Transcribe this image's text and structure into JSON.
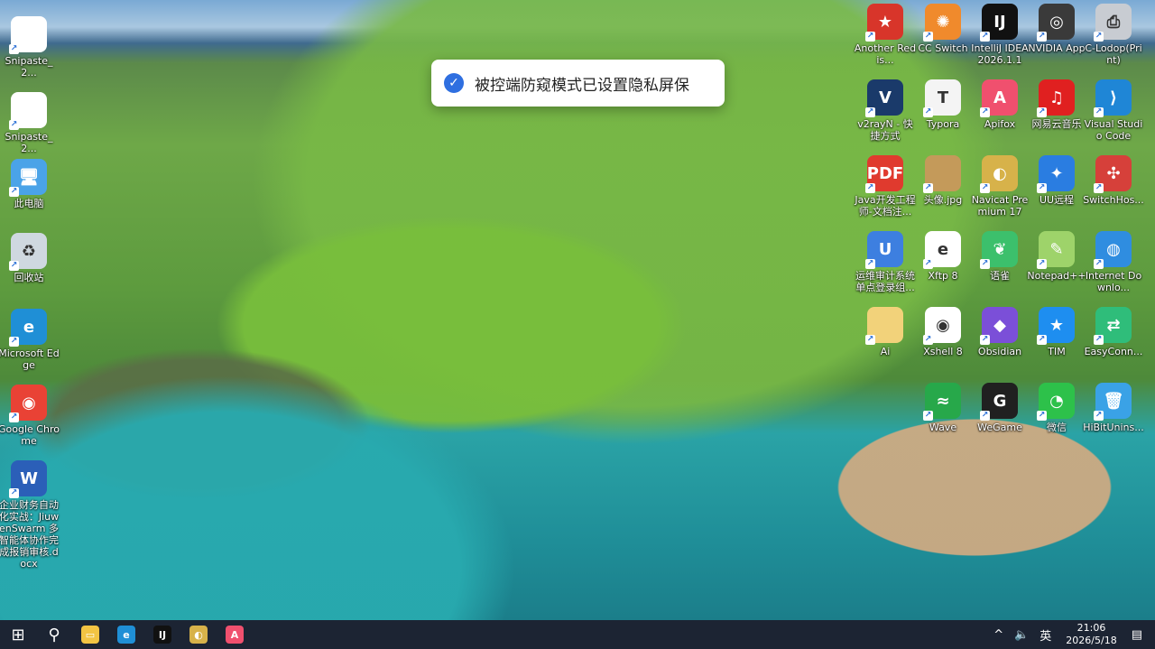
{
  "toast": {
    "message": "被控端防窥模式已设置隐私屏保"
  },
  "left_icons": [
    {
      "name": "snipaste-1",
      "label": "Snipaste_2...",
      "glyph": "",
      "bg": "#ffffff"
    },
    {
      "name": "snipaste-2",
      "label": "Snipaste_2...",
      "glyph": "",
      "bg": "#ffffff"
    },
    {
      "name": "this-pc",
      "label": "此电脑",
      "glyph": "🖥",
      "bg": "#4aa3e8"
    },
    {
      "name": "recycle-bin",
      "label": "回收站",
      "glyph": "♻",
      "bg": "#cfd8e0"
    },
    {
      "name": "edge",
      "label": "Microsoft Edge",
      "glyph": "e",
      "bg": "#1f8fd6"
    },
    {
      "name": "chrome",
      "label": "Google Chrome",
      "glyph": "◉",
      "bg": "#e94235"
    },
    {
      "name": "word-doc",
      "label": "企业财务自动化实战：JiuwenSwarm 多智能体协作完成报销审核.docx",
      "glyph": "W",
      "bg": "#2b5fb8"
    }
  ],
  "right_icons": [
    {
      "name": "another-redis",
      "label": "Another Redis...",
      "glyph": "★",
      "bg": "#d8352a"
    },
    {
      "name": "cc-switch",
      "label": "CC Switch",
      "glyph": "✺",
      "bg": "#f08a2c"
    },
    {
      "name": "intellij-idea",
      "label": "IntelliJ IDEA 2026.1.1",
      "glyph": "IJ",
      "bg": "#111111"
    },
    {
      "name": "nvidia-app",
      "label": "NVIDIA App",
      "glyph": "◎",
      "bg": "#3a3a3a"
    },
    {
      "name": "c-lodop",
      "label": "C-Lodop(Print)",
      "glyph": "⎙",
      "bg": "#c8ccd2"
    },
    {
      "name": "v2rayn",
      "label": "v2rayN - 快捷方式",
      "glyph": "V",
      "bg": "#1a3a6a"
    },
    {
      "name": "typora",
      "label": "Typora",
      "glyph": "T",
      "bg": "#f4f4f4"
    },
    {
      "name": "apifox",
      "label": "Apifox",
      "glyph": "A",
      "bg": "#f0506e"
    },
    {
      "name": "netease-music",
      "label": "网易云音乐",
      "glyph": "♫",
      "bg": "#e02020"
    },
    {
      "name": "vscode",
      "label": "Visual Studio Code",
      "glyph": "⟩",
      "bg": "#1f86d6"
    },
    {
      "name": "java-pdf",
      "label": "Java开发工程师-文档注...",
      "glyph": "PDF",
      "bg": "#e03a2e"
    },
    {
      "name": "avatar-jpg",
      "label": "头像.jpg",
      "glyph": "",
      "bg": "#c49a5a"
    },
    {
      "name": "navicat",
      "label": "Navicat Premium 17",
      "glyph": "◐",
      "bg": "#d7b24a"
    },
    {
      "name": "uu-remote",
      "label": "UU远程",
      "glyph": "✦",
      "bg": "#2a7de1"
    },
    {
      "name": "switchhosts",
      "label": "SwitchHos...",
      "glyph": "✣",
      "bg": "#d6403a"
    },
    {
      "name": "audit-sso",
      "label": "运维审计系统单点登录组...",
      "glyph": "U",
      "bg": "#3d7fe0"
    },
    {
      "name": "xftp",
      "label": "Xftp 8",
      "glyph": "e",
      "bg": "#ffffff"
    },
    {
      "name": "yuque",
      "label": "语雀",
      "glyph": "❦",
      "bg": "#3cc06c"
    },
    {
      "name": "notepadpp",
      "label": "Notepad++",
      "glyph": "✎",
      "bg": "#9ed36a"
    },
    {
      "name": "idm",
      "label": "Internet Downlo...",
      "glyph": "◍",
      "bg": "#2f8de0"
    },
    {
      "name": "ai-folder",
      "label": "Ai",
      "glyph": "",
      "bg": "#f2d27a"
    },
    {
      "name": "xshell",
      "label": "Xshell 8",
      "glyph": "◉",
      "bg": "#ffffff"
    },
    {
      "name": "obsidian",
      "label": "Obsidian",
      "glyph": "◆",
      "bg": "#7b4fd8"
    },
    {
      "name": "tim",
      "label": "TIM",
      "glyph": "★",
      "bg": "#1e8ef0"
    },
    {
      "name": "easyconnect",
      "label": "EasyConn...",
      "glyph": "⇄",
      "bg": "#2fbd7a"
    },
    {
      "name": "wave",
      "label": "Wave",
      "glyph": "≈",
      "bg": "#27a84a"
    },
    {
      "name": "wegame",
      "label": "WeGame",
      "glyph": "G",
      "bg": "#202020"
    },
    {
      "name": "wechat",
      "label": "微信",
      "glyph": "◔",
      "bg": "#2dc14a"
    },
    {
      "name": "hibit-uninstaller",
      "label": "HiBitUnins...",
      "glyph": "🗑",
      "bg": "#3aa2e6"
    }
  ],
  "taskbar": {
    "apps": [
      {
        "name": "start-icon",
        "glyph": "⊞",
        "bg": "transparent"
      },
      {
        "name": "search-icon",
        "glyph": "⚲",
        "bg": "transparent"
      },
      {
        "name": "file-explorer-icon",
        "glyph": "▭",
        "bg": "#f2c443"
      },
      {
        "name": "edge-icon",
        "glyph": "e",
        "bg": "#1f8fd6"
      },
      {
        "name": "intellij-icon",
        "glyph": "IJ",
        "bg": "#111111"
      },
      {
        "name": "navicat-icon",
        "glyph": "◐",
        "bg": "#d7b24a"
      },
      {
        "name": "apifox-icon",
        "glyph": "A",
        "bg": "#f0506e"
      }
    ],
    "tray": {
      "chevron": "^",
      "volume": "🔈",
      "ime": "英",
      "time": "21:06",
      "date": "2026/5/18",
      "notification": "▤"
    }
  }
}
